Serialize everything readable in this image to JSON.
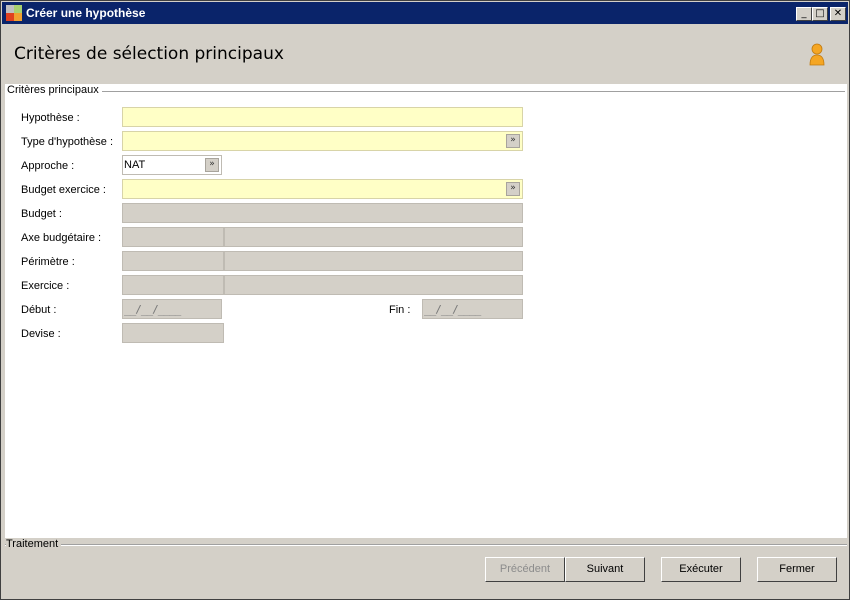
{
  "window": {
    "title": "Créer une hypothèse",
    "min_label": "_",
    "max_label": "□",
    "close_label": "✕"
  },
  "header": {
    "title": "Critères de sélection principaux",
    "icon": "user-icon"
  },
  "main_group": {
    "label": "Critères principaux"
  },
  "fields": {
    "hypothese": {
      "label": "Hypothèse :",
      "value": ""
    },
    "type_hypothese": {
      "label": "Type d'hypothèse :",
      "value": ""
    },
    "approche": {
      "label": "Approche :",
      "value": "NAT"
    },
    "budget_exercice": {
      "label": "Budget exercice :",
      "value": ""
    },
    "budget": {
      "label": "Budget :",
      "value": ""
    },
    "axe_budgetaire": {
      "label": "Axe budgétaire :",
      "code": "",
      "desc": ""
    },
    "perimetre": {
      "label": "Périmètre :",
      "code": "",
      "desc": ""
    },
    "exercice": {
      "label": "Exercice :",
      "code": "",
      "desc": ""
    },
    "debut": {
      "label": "Début :",
      "mask": "__/__/____"
    },
    "fin": {
      "label": "Fin :",
      "mask": "__/__/____"
    },
    "devise": {
      "label": "Devise :",
      "value": ""
    }
  },
  "footer": {
    "group_label": "Traitement",
    "buttons": {
      "precedent": "Précédent",
      "suivant": "Suivant",
      "executer": "Exécuter",
      "fermer": "Fermer"
    }
  },
  "colors": {
    "titlebar": "#0a246a",
    "required_field": "#ffffc6",
    "readonly_field": "#d4d0c8"
  }
}
